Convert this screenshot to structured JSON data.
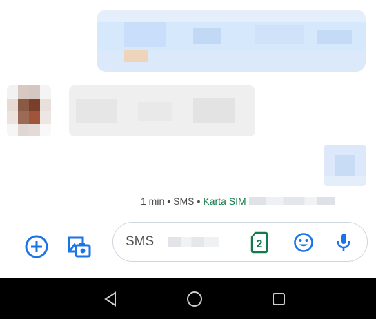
{
  "conversation": {
    "message_meta": {
      "time": "1 min",
      "separator": "•",
      "channel": "SMS",
      "sim_label": "Karta SIM"
    }
  },
  "composer": {
    "field_label": "SMS",
    "sim_slot": "2",
    "icons": {
      "add": "add-circle-icon",
      "gallery": "gallery-camera-icon",
      "sim": "sim-card-icon",
      "emoji": "emoji-icon",
      "mic": "microphone-icon"
    }
  },
  "navbar": {
    "icons": [
      "back-triangle-icon",
      "home-circle-icon",
      "recents-square-icon"
    ]
  },
  "colors": {
    "accent": "#1a73e8",
    "sim_green": "#137a4a",
    "navbar_bg": "#000000"
  }
}
